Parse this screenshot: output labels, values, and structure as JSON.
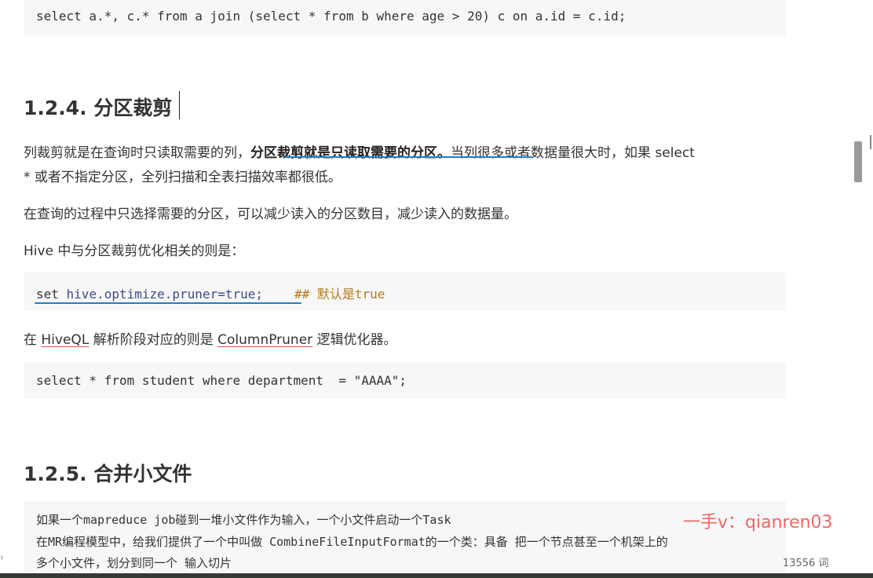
{
  "code_top": "select a.*, c.* from a join (select * from b where age > 20) c on a.id = c.id;",
  "section_124": {
    "title": "1.2.4. 分区裁剪"
  },
  "para1": {
    "part1": "列裁剪就是在查询时只读取需要的列，",
    "bold": "分区裁剪就是只读取需要的分区。",
    "part2": "当列很多或者数据量很大时，如果 select",
    "line2": "* 或者不指定分区，全列扫描和全表扫描效率都很低。"
  },
  "para2": "在查询的过程中只选择需要的分区，可以减少读入的分区数目，减少读入的数据量。",
  "para3": "Hive 中与分区裁剪优化相关的则是：",
  "code_set": {
    "kw": "set",
    "prop": " hive.optimize.pruner",
    "rest": "=true;",
    "comment": "## 默认是true"
  },
  "para4": {
    "pre": "在 ",
    "link1": "HiveQL",
    "mid": " 解析阶段对应的则是 ",
    "link2": "ColumnPruner",
    "post": " 逻辑优化器。"
  },
  "code_select": "select * from student where department  = \"AAAA\";",
  "section_125": {
    "title": "1.2.5. 合并小文件"
  },
  "code_merge": {
    "line1": "如果一个mapreduce job碰到一堆小文件作为输入，一个小文件启动一个Task",
    "line2": "在MR编程模型中，给我们提供了一个中叫做 CombineFileInputFormat的一个类：具备 把一个节点甚至一个机架上的",
    "line3": "多个小文件，划分到同一个 输入切片"
  },
  "watermark": "一手v：qianren03",
  "word_count": "13556 词",
  "colors": {
    "pen": "#1f7fc4",
    "watermark": "#f06666",
    "code_bg": "#f7f7f7"
  }
}
